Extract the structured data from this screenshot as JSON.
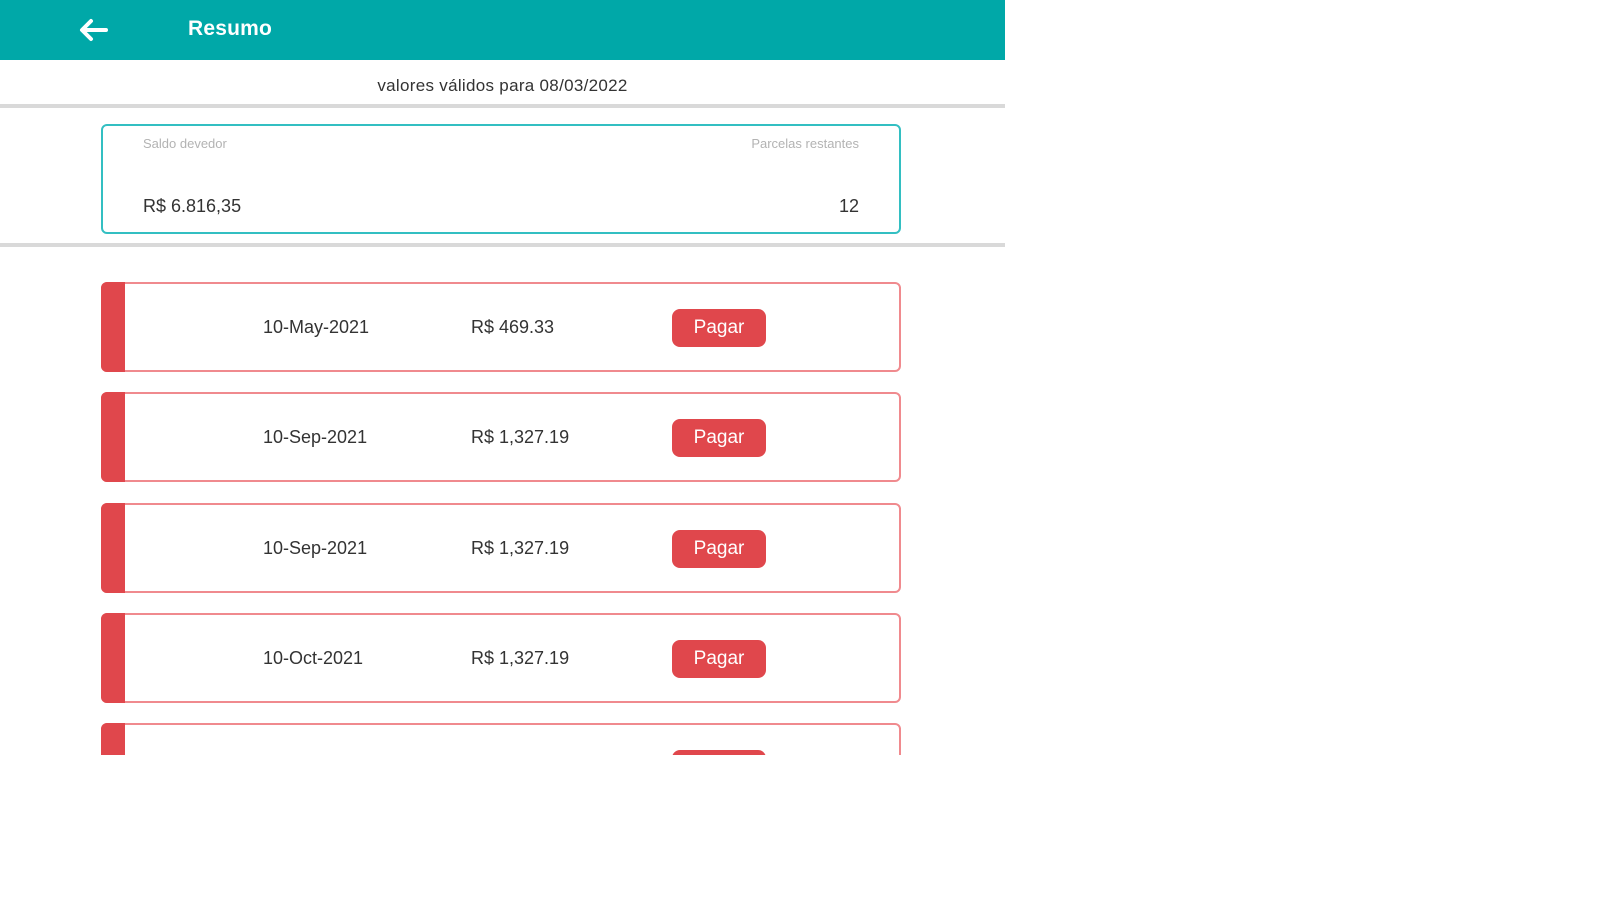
{
  "header": {
    "title": "Resumo",
    "back_icon": "arrow-left-icon"
  },
  "validity_text": "valores válidos para 08/03/2022",
  "summary": {
    "balance_label": "Saldo devedor",
    "balance_value": "R$ 6.816,35",
    "installments_label": "Parcelas restantes",
    "installments_value": "12"
  },
  "installments": [
    {
      "date": "10-May-2021",
      "amount": "R$ 469.33",
      "action_label": "Pagar"
    },
    {
      "date": "10-Sep-2021",
      "amount": "R$ 1,327.19",
      "action_label": "Pagar"
    },
    {
      "date": "10-Sep-2021",
      "amount": "R$ 1,327.19",
      "action_label": "Pagar"
    },
    {
      "date": "10-Oct-2021",
      "amount": "R$ 1,327.19",
      "action_label": "Pagar"
    },
    {
      "date": "",
      "amount": "",
      "action_label": ""
    }
  ],
  "colors": {
    "header": "#00A8A8",
    "summary_border": "#33BFC2",
    "overdue_accent": "#E0474C",
    "row_border": "#F08A8E"
  }
}
